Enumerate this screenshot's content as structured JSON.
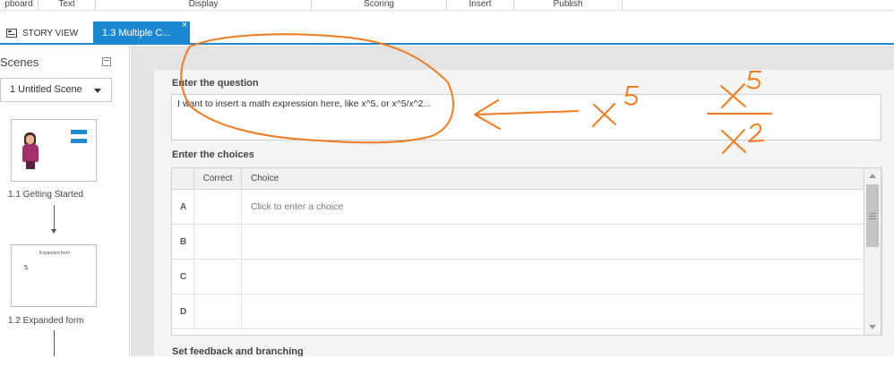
{
  "ribbon": {
    "groups": [
      "pboard",
      "Text",
      "Display",
      "Scoring",
      "Insert",
      "Publish"
    ]
  },
  "tabs": {
    "story_view": "STORY VIEW",
    "active": "1.3 Multiple C...",
    "close": "×"
  },
  "scenes": {
    "title": "Scenes",
    "selected_scene": "1 Untitled Scene",
    "slides": [
      {
        "caption": "1.1 Getting Started"
      },
      {
        "caption": "1.2 Expanded form",
        "thumb_title": "Expanded form",
        "thumb_value": "5"
      }
    ]
  },
  "question": {
    "label": "Enter the question",
    "text": "I want to insert a math expression here, like x^5, or x^5/x^2..."
  },
  "choices": {
    "label": "Enter the choices",
    "header_correct": "Correct",
    "header_choice": "Choice",
    "rows": [
      {
        "letter": "A",
        "text": "Click to enter a choice"
      },
      {
        "letter": "B",
        "text": ""
      },
      {
        "letter": "C",
        "text": ""
      },
      {
        "letter": "D",
        "text": ""
      }
    ]
  },
  "feedback": {
    "label": "Set feedback and branching"
  },
  "annotation": {
    "color": "#f07a1e"
  },
  "colors": {
    "accent": "#1e88d0"
  }
}
